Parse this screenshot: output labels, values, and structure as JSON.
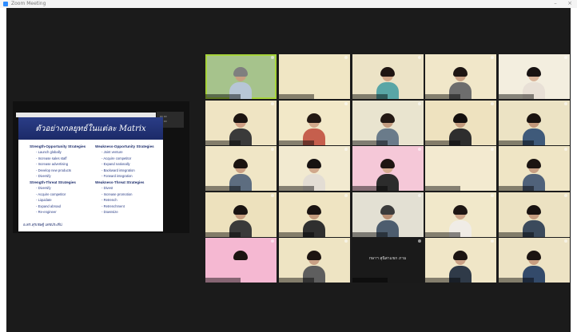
{
  "window": {
    "title": "Zoom Meeting"
  },
  "slide": {
    "title": "ตัวอย่างกลยุทธ์ในแต่ละ Matrix",
    "columns": [
      {
        "sections": [
          {
            "heading": "Strength-Opportunity Strategies",
            "items": [
              "Launch globally",
              "Increase sales staff",
              "Increase advertising",
              "Develop new products",
              "Diversify"
            ]
          },
          {
            "heading": "Strength-Threat Strategies",
            "items": [
              "Diversify",
              "Acquire competitor",
              "Liquidate",
              "Expand abroad",
              "Re-engineer"
            ]
          }
        ]
      },
      {
        "sections": [
          {
            "heading": "Weakness-Opportunity Strategies",
            "items": [
              "Joint venture",
              "Acquire competitor",
              "Expand nationally",
              "Backward integration",
              "Forward integration"
            ]
          },
          {
            "heading": "Weakness-Threat Strategies",
            "items": [
              "Divest",
              "Increase promotion",
              "Retrench",
              "Retrenchment",
              "Downsize"
            ]
          }
        ]
      }
    ],
    "footer": "อ.ดร.สุรเชษฐ์ เดชประทีป"
  },
  "participants": [
    {
      "name": "",
      "bg": "#a6c38c",
      "skin": "#c89f80",
      "hair": "#7f7f7f",
      "shirt": "#b7c6d6",
      "active": true
    },
    {
      "name": "",
      "bg": "#f0e6c4",
      "skin": "",
      "hair": "",
      "shirt": ""
    },
    {
      "name": "",
      "bg": "#ece3c6",
      "skin": "#d2a788",
      "hair": "#1f1512",
      "shirt": "#59a6a6"
    },
    {
      "name": "",
      "bg": "#f1e7c9",
      "skin": "#caa285",
      "hair": "#1e1613",
      "shirt": "#6d6d6d"
    },
    {
      "name": "",
      "bg": "#f3eedf",
      "skin": "#d8b49a",
      "hair": "#171212",
      "shirt": "#e8e0d6"
    },
    {
      "name": "",
      "bg": "#efe4c3",
      "skin": "#cf9f84",
      "hair": "#1c1411",
      "shirt": "#3a3a3a"
    },
    {
      "name": "",
      "bg": "#f2e8c8",
      "skin": "#d4aa8c",
      "hair": "#241914",
      "shirt": "#c65f4d"
    },
    {
      "name": "",
      "bg": "#e9e4cf",
      "skin": "#c39c80",
      "hair": "#241914",
      "shirt": "#6a7b8a"
    },
    {
      "name": "",
      "bg": "#eee2bf",
      "skin": "#c29a7c",
      "hair": "#15100e",
      "shirt": "#2e2e2e"
    },
    {
      "name": "",
      "bg": "#ece3c4",
      "skin": "#c2987b",
      "hair": "#1a1310",
      "shirt": "#3f5a7a"
    },
    {
      "name": "",
      "bg": "#f0e6c6",
      "skin": "#caa084",
      "hair": "#1a1310",
      "shirt": "#5d6d80"
    },
    {
      "name": "",
      "bg": "#f2ead0",
      "skin": "#d0a88b",
      "hair": "#171211",
      "shirt": "#e3ddd4"
    },
    {
      "name": "",
      "bg": "#f5c8d8",
      "skin": "#d6ad92",
      "hair": "#1e1512",
      "shirt": "#2c2c2c"
    },
    {
      "name": "",
      "bg": "#f3ead0",
      "skin": "",
      "hair": "",
      "shirt": ""
    },
    {
      "name": "",
      "bg": "#efe5c5",
      "skin": "#c79f83",
      "hair": "#1b1411",
      "shirt": "#50627a"
    },
    {
      "name": "",
      "bg": "#ede1bd",
      "skin": "#c79d7f",
      "hair": "#191311",
      "shirt": "#3a3a3a"
    },
    {
      "name": "",
      "bg": "#efe4c2",
      "skin": "#c49a7c",
      "hair": "#1a1311",
      "shirt": "#2f2f2f"
    },
    {
      "name": "",
      "bg": "#e3e0d3",
      "skin": "#b98f73",
      "hair": "#3b3b3b",
      "shirt": "#4d5d6e"
    },
    {
      "name": "",
      "bg": "#f1e8ca",
      "skin": "#cfa68a",
      "hair": "#1e1613",
      "shirt": "#f0ece6"
    },
    {
      "name": "",
      "bg": "#ece2c2",
      "skin": "#c59c7f",
      "hair": "#181210",
      "shirt": "#3b4a5c"
    },
    {
      "name": "",
      "bg": "#f5b8d2",
      "skin": "",
      "hair": "#1b1411",
      "shirt": ""
    },
    {
      "name": "",
      "bg": "#eee4c3",
      "skin": "#c8a085",
      "hair": "#1c1411",
      "shirt": "#5e5e5e"
    },
    {
      "name": "",
      "bg": "#1a1a1a",
      "skin": "",
      "hair": "",
      "shirt": "",
      "label": "กษาฯ สุนิสาแขก ภาม"
    },
    {
      "name": "",
      "bg": "#f0e6c7",
      "skin": "#caa186",
      "hair": "#1b1411",
      "shirt": "#2f3a48"
    },
    {
      "name": "",
      "bg": "#ede3c4",
      "skin": "#c79d80",
      "hair": "#1b1411",
      "shirt": "#334a6a"
    }
  ]
}
